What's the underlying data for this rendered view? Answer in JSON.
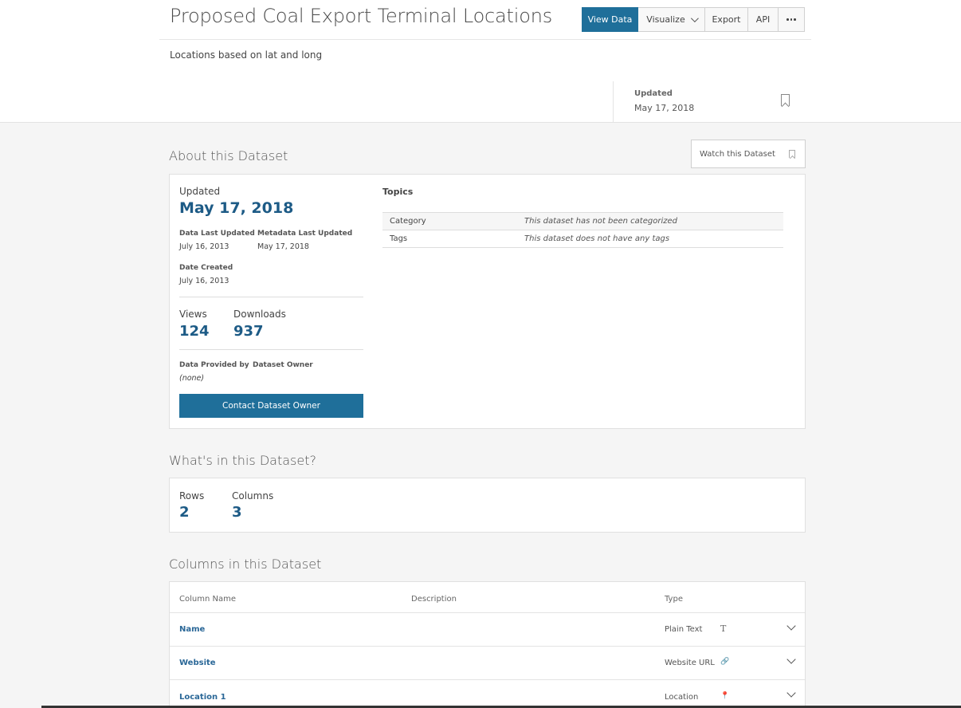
{
  "header": {
    "title": "Proposed Coal Export Terminal Locations",
    "description": "Locations based on lat and long",
    "buttons": {
      "view_data": "View Data",
      "visualize": "Visualize",
      "export": "Export",
      "api": "API"
    },
    "updated_label": "Updated",
    "updated_value": "May 17, 2018"
  },
  "about": {
    "heading": "About this Dataset",
    "watch_label": "Watch this Dataset",
    "updated_label": "Updated",
    "updated_value": "May 17, 2018",
    "data_last_updated_label": "Data Last Updated",
    "data_last_updated_value": "July 16, 2013",
    "metadata_last_updated_label": "Metadata Last Updated",
    "metadata_last_updated_value": "May 17, 2018",
    "date_created_label": "Date Created",
    "date_created_value": "July 16, 2013",
    "views_label": "Views",
    "views_value": "124",
    "downloads_label": "Downloads",
    "downloads_value": "937",
    "provided_by_label": "Data Provided by",
    "provided_by_value": "(none)",
    "owner_label": "Dataset Owner",
    "contact_button": "Contact Dataset Owner",
    "topics": {
      "title": "Topics",
      "rows": [
        {
          "key": "Category",
          "value": "This dataset has not been categorized"
        },
        {
          "key": "Tags",
          "value": "This dataset does not have any tags"
        }
      ]
    }
  },
  "whats_in": {
    "heading": "What's in this Dataset?",
    "rows_label": "Rows",
    "rows_value": "2",
    "columns_label": "Columns",
    "columns_value": "3"
  },
  "columns": {
    "heading": "Columns in this Dataset",
    "headers": {
      "name": "Column Name",
      "description": "Description",
      "type": "Type"
    },
    "rows": [
      {
        "name": "Name",
        "type": "Plain Text",
        "icon": "T"
      },
      {
        "name": "Website",
        "type": "Website URL",
        "icon": "🔗"
      },
      {
        "name": "Location 1",
        "type": "Location",
        "icon": "📍"
      }
    ]
  }
}
